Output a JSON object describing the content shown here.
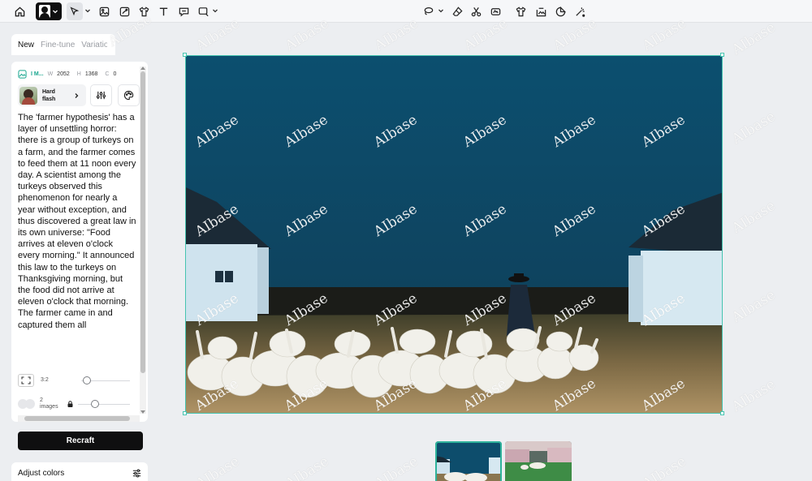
{
  "panel": {
    "tabs": [
      "New",
      "Fine-tune",
      "Variations"
    ],
    "meta": {
      "title": "I M...",
      "w_label": "W",
      "w_value": "2052",
      "h_label": "H",
      "h_value": "1368",
      "c_label": "C",
      "c_value": "0"
    },
    "style_name": "Hard flash",
    "prompt": "The 'farmer hypothesis' has a layer of unsettling horror: there is a group of turkeys on a farm, and the farmer comes to feed them at 11 noon every day. A scientist among the turkeys observed this phenomenon for nearly a year without exception, and thus discovered a great law in its own universe: \"Food arrives at eleven o'clock every morning.\" It announced this law to the turkeys on Thanksgiving morning, but the food did not arrive at eleven o'clock that morning. The farmer came in and captured them all",
    "aspect_ratio": "3:2",
    "image_count_value": "2",
    "image_count_unit": "images",
    "recraft_label": "Recraft",
    "adjust_label": "Adjust colors"
  },
  "watermark": "AIbase",
  "colors": {
    "accent": "#19a68f",
    "selection": "#46c4b0",
    "primary_button": "#0f0f10"
  },
  "icons": {
    "toolbar": [
      "home-icon",
      "avatar-style-icon",
      "select-arrow-icon",
      "image-icon",
      "vector-icon",
      "mockup-shirt-icon",
      "text-icon",
      "chat-icon",
      "frame-icon",
      "lasso-icon",
      "eraser-icon",
      "scissors-icon",
      "vectorize-icon",
      "shirt-icon",
      "remove-bg-icon",
      "sticker-icon",
      "magic-icon"
    ]
  }
}
